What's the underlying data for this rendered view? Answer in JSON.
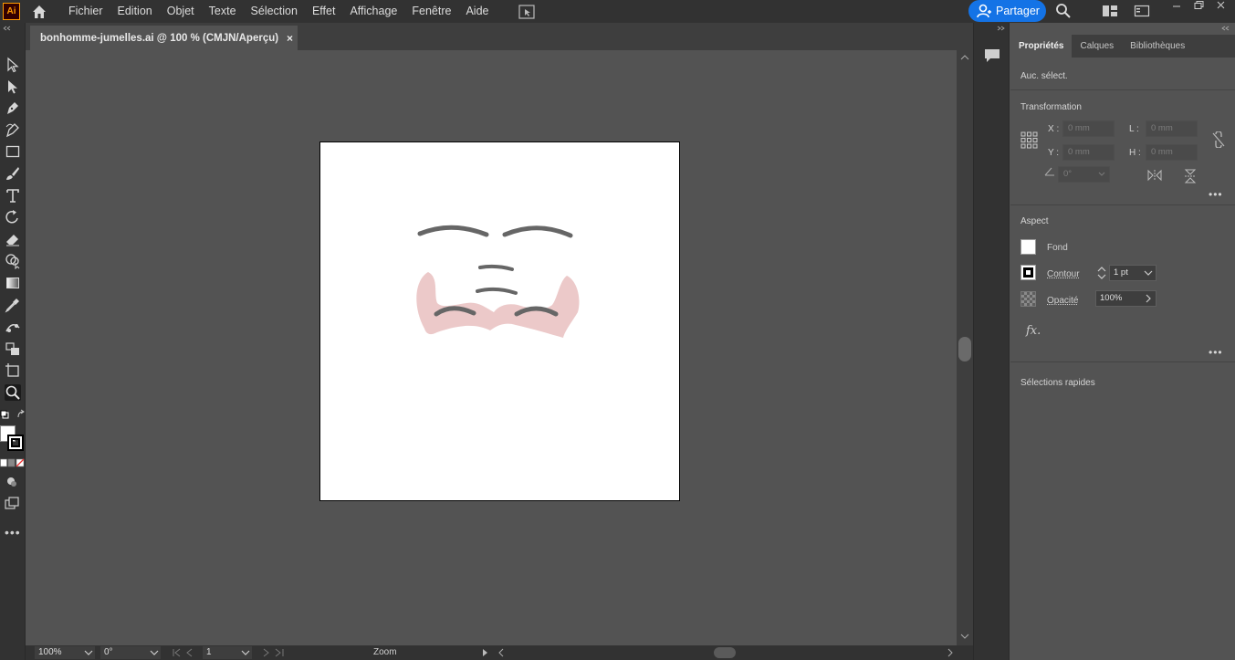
{
  "app": {
    "logo": "Ai"
  },
  "menu": [
    "Fichier",
    "Edition",
    "Objet",
    "Texte",
    "Sélection",
    "Effet",
    "Affichage",
    "Fenêtre",
    "Aide"
  ],
  "share": {
    "label": "Partager"
  },
  "document": {
    "tab_title": "bonhomme-jumelles.ai @ 100 % (CMJN/Aperçu)",
    "close": "×"
  },
  "status": {
    "zoom": "100%",
    "rotation": "0°",
    "artboard": "1",
    "tool": "Zoom"
  },
  "panel": {
    "tabs": [
      "Propriétés",
      "Calques",
      "Bibliothèques"
    ],
    "no_selection": "Auc. sélect.",
    "transform": {
      "title": "Transformation",
      "x_label": "X :",
      "x_value": "0 mm",
      "y_label": "Y :",
      "y_value": "0 mm",
      "w_label": "L :",
      "w_value": "0 mm",
      "h_label": "H :",
      "h_value": "0 mm",
      "angle_value": "0°"
    },
    "appearance": {
      "title": "Aspect",
      "fill_label": "Fond",
      "stroke_label": "Contour",
      "stroke_weight": "1 pt",
      "opacity_label": "Opacité",
      "opacity_value": "100%",
      "fx_label": "fx."
    },
    "quick_actions": {
      "title": "Sélections rapides"
    }
  },
  "colors": {
    "accent": "#1473e6",
    "artwork_stroke": "#666666",
    "artwork_fill": "#ecc9c9"
  }
}
